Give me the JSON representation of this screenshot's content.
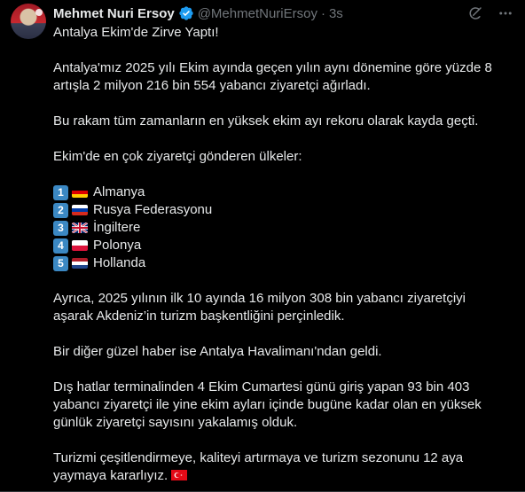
{
  "author": {
    "name": "Mehmet Nuri Ersoy",
    "handle": "@MehmetNuriErsoy",
    "separator": "·",
    "time": "3s"
  },
  "icons": {
    "verified": "verified-badge-icon",
    "grok": "grok-icon",
    "more": "more-icon"
  },
  "colors": {
    "background": "#000000",
    "text": "#e7e9ea",
    "muted": "#71767b",
    "verified": "#1d9bf0",
    "keycap": "#3b88c3"
  },
  "tweet": {
    "title": "Antalya Ekim'de Zirve Yaptı!",
    "p1_line1": "Antalya'mız 2025 yılı Ekim ayında geçen yılın aynı dönemine göre yüzde 8",
    "p1_line2": "artışla 2 milyon 216 bin 554 yabancı ziyaretçi ağırladı.",
    "p2": "Bu rakam tüm zamanların en yüksek ekim ayı rekoru olarak kayda geçti.",
    "list_title": "Ekim'de en çok ziyaretçi gönderen ülkeler:",
    "countries": [
      {
        "rank": "1",
        "flag": "germany-flag-icon",
        "name": "Almanya"
      },
      {
        "rank": "2",
        "flag": "russia-flag-icon",
        "name": "Rusya Federasyonu"
      },
      {
        "rank": "3",
        "flag": "uk-flag-icon",
        "name": "İngiltere"
      },
      {
        "rank": "4",
        "flag": "poland-flag-icon",
        "name": "Polonya"
      },
      {
        "rank": "5",
        "flag": "netherlands-flag-icon",
        "name": "Hollanda"
      }
    ],
    "p3_line1": "Ayrıca, 2025 yılının ilk 10 ayında 16 milyon 308 bin yabancı ziyaretçiyi",
    "p3_line2": "aşarak Akdeniz’in turizm başkentliğini perçinledik.",
    "p4": "Bir diğer güzel haber ise Antalya Havalimanı'ndan geldi.",
    "p5_line1": "Dış hatlar terminalinden 4 Ekim Cumartesi günü giriş yapan 93 bin 403",
    "p5_line2": "yabancı ziyaretçi ile yine ekim ayları içinde bugüne kadar olan en yüksek",
    "p5_line3": "günlük ziyaretçi sayısını yakalamış olduk.",
    "p6_line1": "Turizmi çeşitlendirmeye, kaliteyi artırmaya ve turizm sezonunu 12 aya",
    "p6_line2": "yaymaya kararlıyız.",
    "end_flag": "turkey-flag-icon"
  }
}
